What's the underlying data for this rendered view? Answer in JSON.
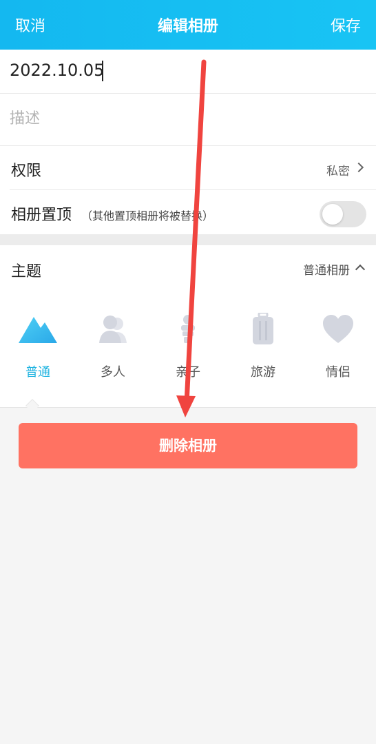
{
  "header": {
    "cancel_label": "取消",
    "title": "编辑相册",
    "save_label": "保存"
  },
  "form": {
    "name_value": "2022.10.05",
    "description_placeholder": "描述",
    "permission_label": "权限",
    "permission_value": "私密",
    "pin_label": "相册置顶",
    "pin_hint": "（其他置顶相册将被替换）",
    "pin_enabled": false
  },
  "theme": {
    "label": "主题",
    "selected_value": "普通相册",
    "items": [
      {
        "label": "普通",
        "icon": "mountain-icon",
        "active": true
      },
      {
        "label": "多人",
        "icon": "people-icon",
        "active": false
      },
      {
        "label": "亲子",
        "icon": "family-icon",
        "active": false
      },
      {
        "label": "旅游",
        "icon": "luggage-icon",
        "active": false
      },
      {
        "label": "情侣",
        "icon": "heart-icon",
        "active": false
      }
    ]
  },
  "actions": {
    "delete_label": "删除相册"
  },
  "colors": {
    "header": "#18c4f4",
    "accent": "#1fb3e0",
    "delete": "#ff7262",
    "annotation_arrow": "#f0443f"
  }
}
